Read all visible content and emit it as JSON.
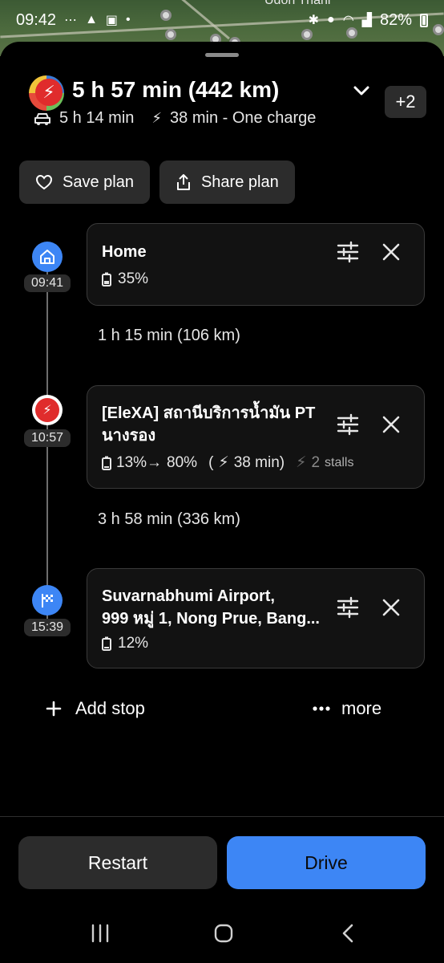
{
  "status_bar": {
    "time": "09:42",
    "battery": "82%",
    "map_label": "Udon Thani"
  },
  "trip": {
    "total": "5 h 57 min (442 km)",
    "drive_time": "5 h 14 min",
    "charge_info": "38 min - One charge",
    "alternatives_badge": "+2"
  },
  "actions": {
    "save_plan": "Save plan",
    "share_plan": "Share plan"
  },
  "stops": [
    {
      "time": "09:41",
      "title": "Home",
      "battery": "35%"
    },
    {
      "time": "10:57",
      "title_line1": "[EleXA] สถานีบริการน้ำมัน PT",
      "title_line2": "นางรอง",
      "charge_from": "13%→",
      "charge_to": "80%",
      "charge_open": "(",
      "charge_duration": "38 min)",
      "stalls_count": "2",
      "stalls_label": "stalls"
    },
    {
      "time": "15:39",
      "title_line1": "Suvarnabhumi Airport,",
      "title_line2": "999 หมู่ 1, Nong Prue, Bang...",
      "battery": "12%"
    }
  ],
  "legs": [
    "1 h 15 min (106 km)",
    "3 h 58 min (336 km)"
  ],
  "footer": {
    "add_stop": "Add stop",
    "more": "more",
    "restart": "Restart",
    "drive": "Drive"
  },
  "colors": {
    "accent": "#3d86f5",
    "charger": "#e02c2c",
    "card": "#121212",
    "button": "#2c2c2c"
  }
}
